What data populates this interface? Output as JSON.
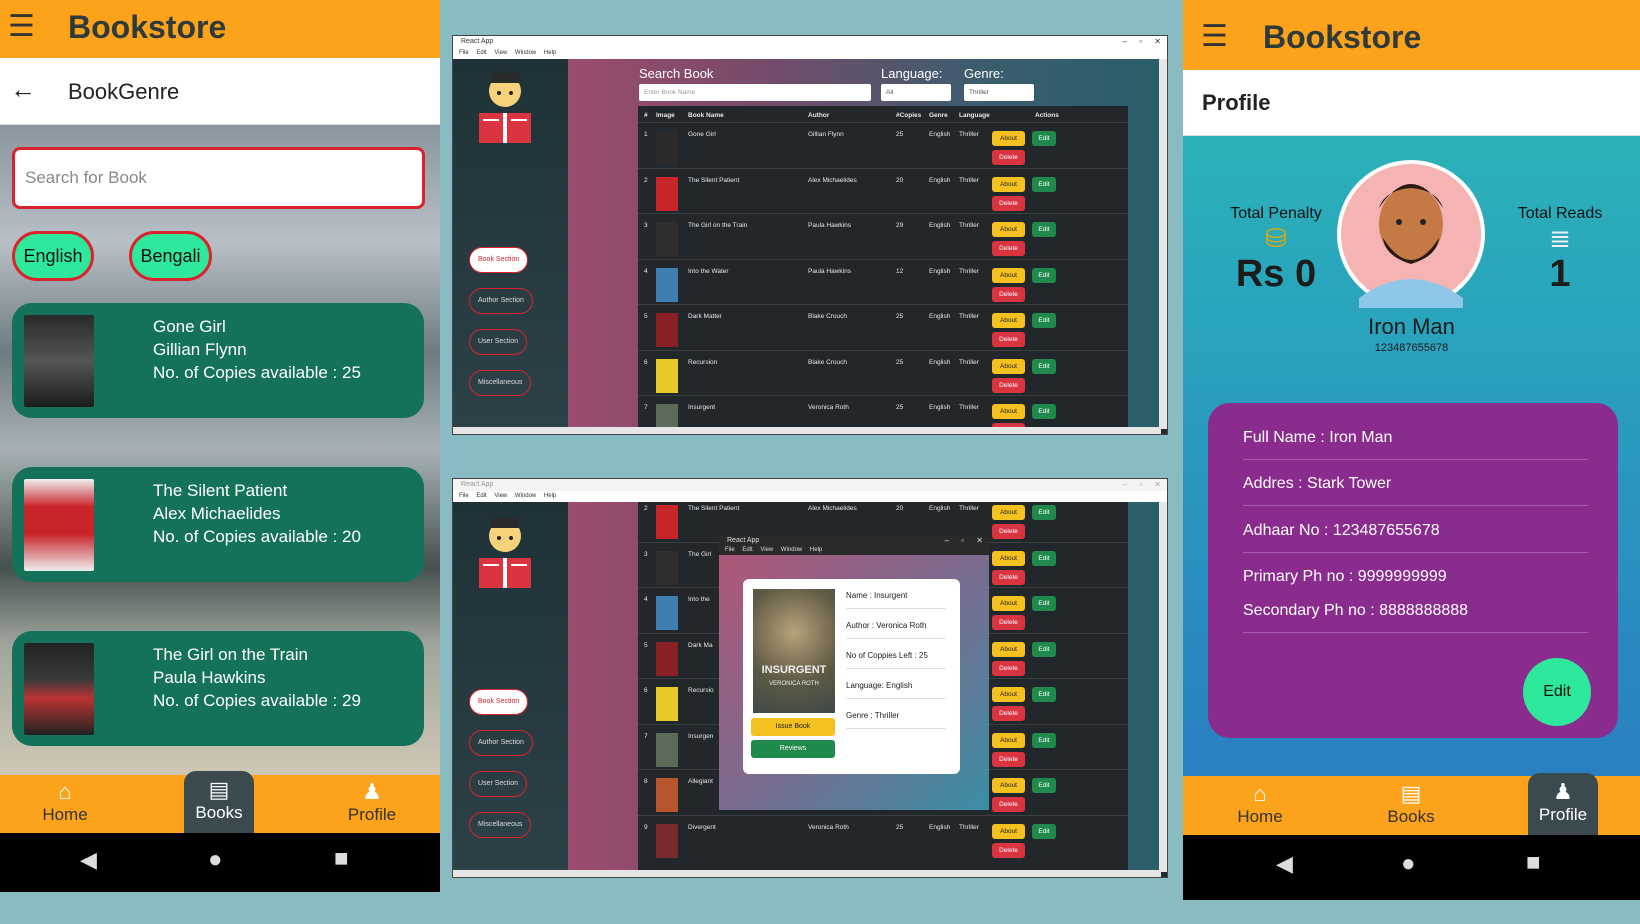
{
  "left_phone": {
    "app_title": "Bookstore",
    "sub_title": "BookGenre",
    "search_placeholder": "Search for Book",
    "chips": [
      "English",
      "Bengali"
    ],
    "cards": [
      {
        "title": "Gone Girl",
        "author": "Gillian Flynn",
        "copies": "No. of Copies available : 25"
      },
      {
        "title": "The Silent Patient",
        "author": "Alex Michaelides",
        "copies": "No. of Copies available : 20"
      },
      {
        "title": "The Girl on the Train",
        "author": "Paula Hawkins",
        "copies": "No. of Copies available : 29"
      }
    ],
    "nav": [
      "Home",
      "Books",
      "Profile"
    ]
  },
  "win1": {
    "title": "React App",
    "menu": "File Edit View Window Help",
    "search_label": "Search Book",
    "search_placeholder": "Enter Book Name",
    "language_label": "Language:",
    "language_value": "All",
    "genre_label": "Genre:",
    "genre_value": "Thriller",
    "sidebar": [
      "Book Section",
      "Author Section",
      "User Section",
      "Miscellaneous"
    ],
    "headers": [
      "#",
      "Image",
      "Book Name",
      "Author",
      "#Copies",
      "Genre",
      "Language",
      "Actions"
    ],
    "rows": [
      {
        "n": "1",
        "name": "Gone Girl",
        "author": "Gillian Flynn",
        "copies": "25",
        "genre": "English",
        "lang": "Thriller"
      },
      {
        "n": "2",
        "name": "The Silent Patient",
        "author": "Alex Michaelides",
        "copies": "20",
        "genre": "English",
        "lang": "Thriller"
      },
      {
        "n": "3",
        "name": "The Girl on the Train",
        "author": "Paula Hawkins",
        "copies": "29",
        "genre": "English",
        "lang": "Thriller"
      },
      {
        "n": "4",
        "name": "Into the Water",
        "author": "Paula Hawkins",
        "copies": "12",
        "genre": "English",
        "lang": "Thriller"
      },
      {
        "n": "5",
        "name": "Dark Matter",
        "author": "Blake Crouch",
        "copies": "25",
        "genre": "English",
        "lang": "Thriller"
      },
      {
        "n": "6",
        "name": "Recursion",
        "author": "Blake Crouch",
        "copies": "25",
        "genre": "English",
        "lang": "Thriller"
      },
      {
        "n": "7",
        "name": "Insurgent",
        "author": "Veronica Roth",
        "copies": "25",
        "genre": "English",
        "lang": "Thriller"
      }
    ],
    "btn_about": "About",
    "btn_edit": "Edit",
    "btn_delete": "Delete"
  },
  "win2": {
    "title": "React App",
    "menu": "File Edit View Window Help",
    "sidebar": [
      "Book Section",
      "Author Section",
      "User Section",
      "Miscellaneous"
    ],
    "rows": [
      {
        "n": "2",
        "name": "The Silent Patient",
        "author": "Alex Michaelides",
        "copies": "20",
        "genre": "English",
        "lang": "Thriller"
      },
      {
        "n": "3",
        "name": "The Girl",
        "author": "",
        "copies": "",
        "genre": "",
        "lang": ""
      },
      {
        "n": "4",
        "name": "Into the",
        "author": "",
        "copies": "",
        "genre": "",
        "lang": ""
      },
      {
        "n": "5",
        "name": "Dark Ma",
        "author": "",
        "copies": "",
        "genre": "",
        "lang": ""
      },
      {
        "n": "6",
        "name": "Recursio",
        "author": "",
        "copies": "",
        "genre": "",
        "lang": ""
      },
      {
        "n": "7",
        "name": "Insurgen",
        "author": "",
        "copies": "",
        "genre": "",
        "lang": ""
      },
      {
        "n": "8",
        "name": "Allegiant",
        "author": "",
        "copies": "",
        "genre": "",
        "lang": ""
      },
      {
        "n": "9",
        "name": "Divergent",
        "author": "Veronica Roth",
        "copies": "25",
        "genre": "English",
        "lang": "Thriller"
      }
    ],
    "popup": {
      "title": "React App",
      "menu": "File Edit View Window Help",
      "cover_title": "INSURGENT",
      "cover_author": "VERONICA ROTH",
      "name": "Name : Insurgent",
      "author": "Author : Veronica Roth",
      "copies": "No of Coppies Left : 25",
      "language": "Language: English",
      "genre": "Genre : Thriller",
      "issue_btn": "Issue Book",
      "reviews_btn": "Reviews"
    }
  },
  "right_phone": {
    "app_title": "Bookstore",
    "sub_title": "Profile",
    "penalty_label": "Total Penalty",
    "penalty_value": "Rs 0",
    "reads_label": "Total Reads",
    "reads_value": "1",
    "user_name": "Iron Man",
    "user_id": "123487655678",
    "details": {
      "full_name": "Full Name : Iron Man",
      "address": "Addres : Stark Tower",
      "adhaar": "Adhaar No : 123487655678",
      "primary": "Primary Ph no : 9999999999",
      "secondary": "Secondary Ph no : 8888888888"
    },
    "edit_btn": "Edit",
    "nav": [
      "Home",
      "Books",
      "Profile"
    ]
  },
  "colors": {
    "accent": "#fda21b",
    "card": "#137259",
    "chip": "#2ee89b",
    "danger": "#d9232e",
    "profile_panel": "#8a2b8e"
  }
}
